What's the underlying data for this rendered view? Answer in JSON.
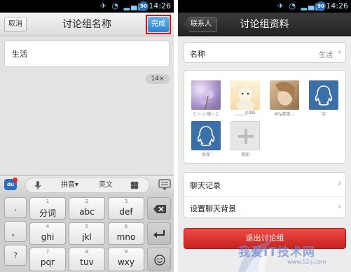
{
  "status_bar": {
    "time": "14:26",
    "badge": "90"
  },
  "left_screen": {
    "cancel_label": "取消",
    "title": "讨论组名称",
    "done_label": "完成",
    "input_value": "生活",
    "char_counter": "14×",
    "keyboard": {
      "logo": "du",
      "mode_label": "拼音▾",
      "english_label": "英文",
      "side_keys": [
        ",",
        "。",
        "?"
      ],
      "keys": [
        {
          "digit": "1",
          "label": "分词"
        },
        {
          "digit": "2",
          "label": "abc"
        },
        {
          "digit": "3",
          "label": "def"
        },
        {
          "digit": "4",
          "label": "ghi"
        },
        {
          "digit": "5",
          "label": "jkl"
        },
        {
          "digit": "6",
          "label": "mno"
        },
        {
          "digit": "7",
          "label": "pqr"
        },
        {
          "digit": "8",
          "label": "tuv"
        },
        {
          "digit": "9",
          "label": "wxy"
        }
      ]
    }
  },
  "right_screen": {
    "back_label": "联系人",
    "title": "讨论组资料",
    "name_label": "名称",
    "name_value": "生活",
    "members": [
      {
        "name": "じ☆ ◇ 瑛☆じ",
        "avatar": "flower-photo"
      },
      {
        "name": "_____JONE",
        "avatar": "teddy-bear-photo"
      },
      {
        "name": "Ally笑笑...",
        "avatar": "girl-photo"
      },
      {
        "name": "宇",
        "avatar": "qq-penguin"
      },
      {
        "name": "水泥",
        "avatar": "qq-penguin"
      }
    ],
    "add_label": "添加",
    "chat_history_label": "聊天记录",
    "chat_background_label": "设置聊天背景",
    "exit_label": "退出讨论组"
  },
  "watermark": {
    "text": "我爱IT技术网",
    "url": "www.52ij.com"
  },
  "colors": {
    "accent_blue": "#2a83cf",
    "highlight_red": "#d8141b",
    "exit_red": "#d9302b",
    "qq_blue": "#3a6faa"
  }
}
